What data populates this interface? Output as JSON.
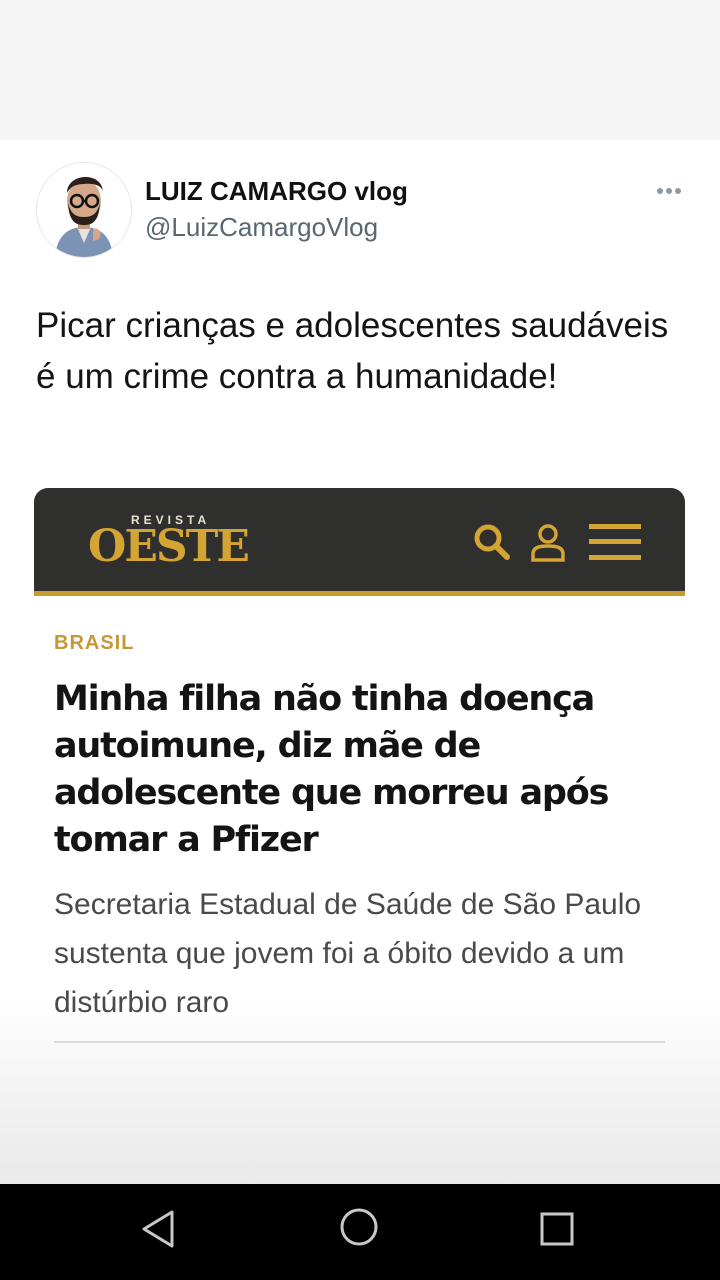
{
  "tweet": {
    "author_name": "LUIZ CAMARGO vlog",
    "author_handle": "@LuizCamargoVlog",
    "text": "Picar crianças e adolescentes saudáveis é um crime contra a humanidade!",
    "more_icon": "more-horizontal-icon"
  },
  "article_card": {
    "logo_small": "REVISTA",
    "logo_main": "OESTE",
    "icons": [
      "search-icon",
      "user-icon",
      "menu-icon"
    ],
    "section": "BRASIL",
    "headline": "Minha filha não tinha doença autoimune, diz mãe de adolescente que morreu após tomar a Pfizer",
    "subheadline": "Secretaria Estadual de Saúde de São Paulo sustenta que jovem foi a óbito devido a um distúrbio raro",
    "colors": {
      "header_bg": "#2f2f2d",
      "accent": "#c79b2e"
    }
  },
  "system_nav": {
    "buttons": [
      "back-icon",
      "home-icon",
      "recents-icon"
    ]
  }
}
